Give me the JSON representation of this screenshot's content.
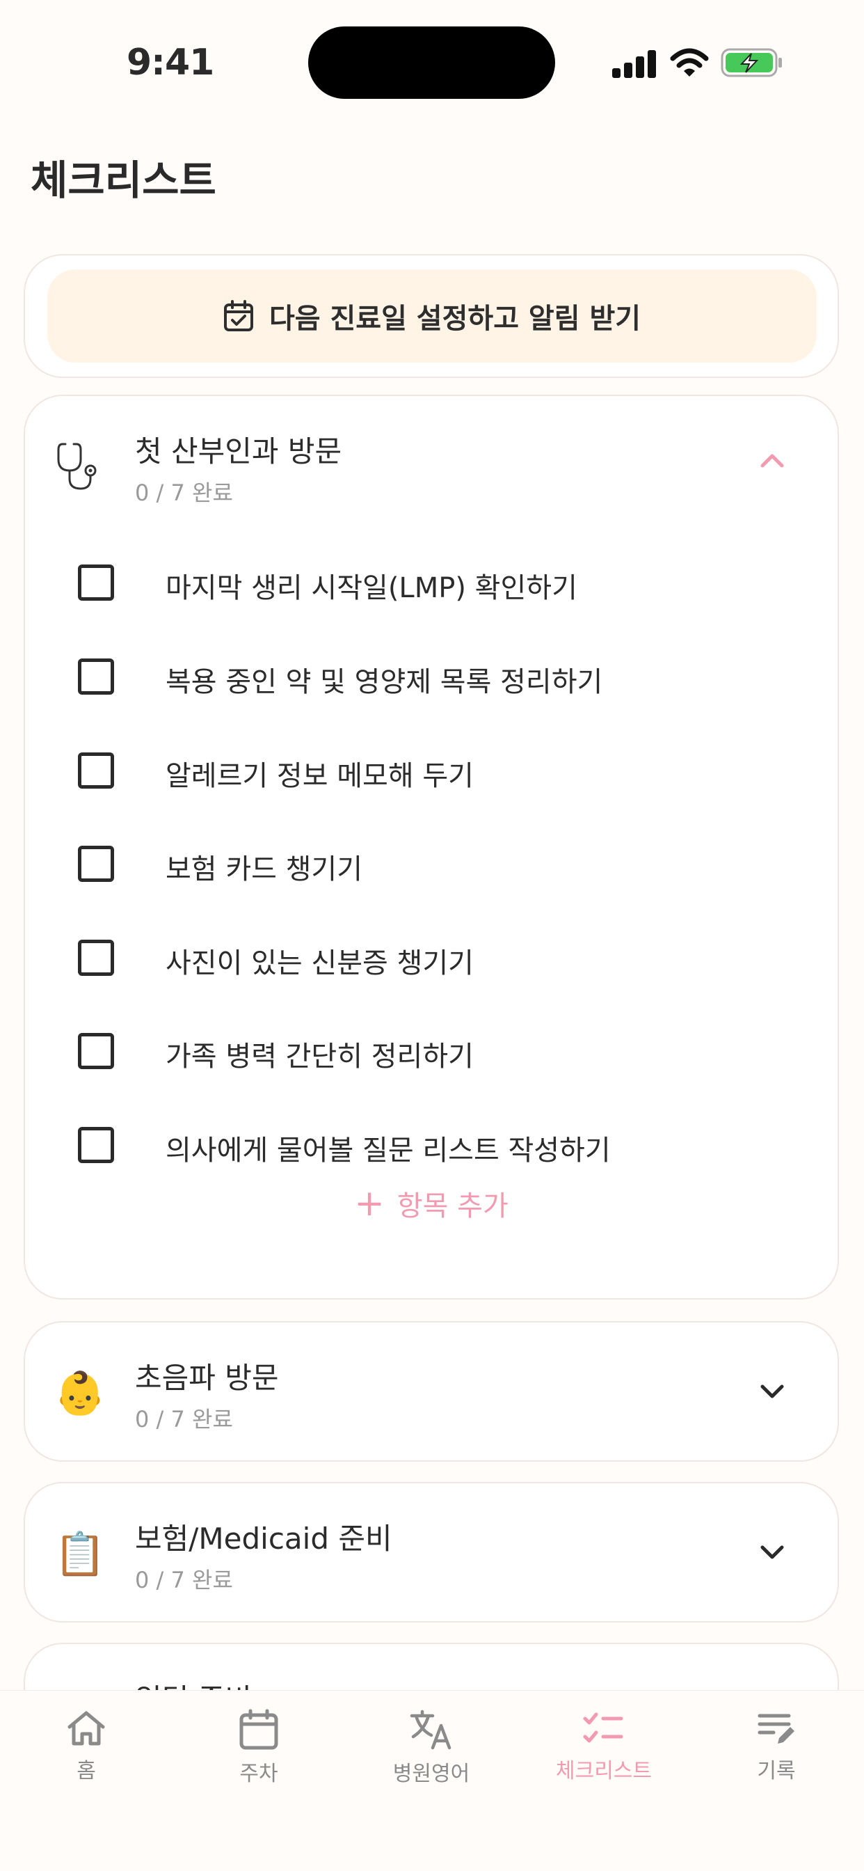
{
  "status_bar": {
    "time": "9:41"
  },
  "page_title": "체크리스트",
  "reminder": {
    "label": "다음 진료일 설정하고 알림 받기",
    "icon": "calendar-check-icon"
  },
  "sections": [
    {
      "title": "첫 산부인과 방문",
      "progress": "0 / 7 완료",
      "icon": "stethoscope-icon",
      "expanded": true,
      "items": [
        {
          "label": "마지막 생리 시작일(LMP) 확인하기",
          "checked": false
        },
        {
          "label": "복용 중인 약 및 영양제 목록 정리하기",
          "checked": false
        },
        {
          "label": "알레르기 정보 메모해 두기",
          "checked": false
        },
        {
          "label": "보험 카드 챙기기",
          "checked": false
        },
        {
          "label": "사진이 있는 신분증 챙기기",
          "checked": false
        },
        {
          "label": "가족 병력 간단히 정리하기",
          "checked": false
        },
        {
          "label": "의사에게 물어볼 질문 리스트 작성하기",
          "checked": false
        }
      ],
      "add_label": "항목 추가"
    },
    {
      "title": "초음파 방문",
      "progress": "0 / 7 완료",
      "icon": "baby-emoji-icon",
      "expanded": false,
      "emoji": "👶"
    },
    {
      "title": "보험/Medicaid 준비",
      "progress": "0 / 7 완료",
      "icon": "clipboard-icon",
      "expanded": false,
      "emoji": "📋"
    },
    {
      "title": "입덧 준비",
      "icon": "partial-icon",
      "expanded": false
    }
  ],
  "nav": [
    {
      "label": "홈",
      "icon": "home-icon",
      "active": false
    },
    {
      "label": "주차",
      "icon": "calendar-icon",
      "active": false
    },
    {
      "label": "병원영어",
      "icon": "translate-icon",
      "active": false
    },
    {
      "label": "체크리스트",
      "icon": "checklist-icon",
      "active": true
    },
    {
      "label": "기록",
      "icon": "notes-edit-icon",
      "active": false
    }
  ],
  "colors": {
    "accent": "#f29bb0",
    "reminder_bg": "#fff4e6",
    "page_bg": "#fffcfa"
  }
}
